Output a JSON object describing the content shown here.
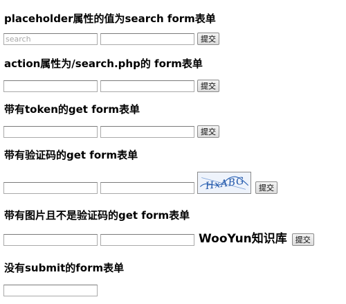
{
  "sections": [
    {
      "heading": "placeholder属性的值为search form表单",
      "field1_placeholder": "search",
      "submit_label": "提交"
    },
    {
      "heading": "action属性为/search.php的 form表单",
      "submit_label": "提交"
    },
    {
      "heading": "带有token的get form表单",
      "submit_label": "提交"
    },
    {
      "heading": "带有验证码的get form表单",
      "captcha_text": "HxABG",
      "submit_label": "提交"
    },
    {
      "heading": "带有图片且不是验证码的get form表单",
      "image_text": "WooYun知识库",
      "submit_label": "提交"
    },
    {
      "heading": "没有submit的form表单"
    }
  ]
}
